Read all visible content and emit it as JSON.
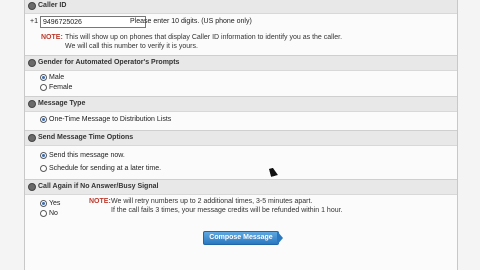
{
  "caller_id": {
    "title": "Caller ID",
    "prefix": "+1",
    "value": "9496725026",
    "hint": "Please enter 10 digits. (US phone only)",
    "note_kw": "NOTE:",
    "note_line1": "This will show up on phones that display Caller ID information to identify you as the caller.",
    "note_line2": "We will call this number to verify it is yours."
  },
  "gender": {
    "title": "Gender for Automated Operator's Prompts",
    "options": [
      "Male",
      "Female"
    ]
  },
  "message_type": {
    "title": "Message Type",
    "option": "One-Time Message to Distribution Lists"
  },
  "send_time": {
    "title": "Send Message Time Options",
    "options": [
      "Send this message now.",
      "Schedule for sending at a later time."
    ]
  },
  "call_again": {
    "title": "Call Again if No Answer/Busy Signal",
    "options": [
      "Yes",
      "No"
    ],
    "note_kw": "NOTE:",
    "note_line1": "We will retry numbers up to 2 additional times, 3-5 minutes apart.",
    "note_line2": "If the call fails 3 times, your message credits will be refunded within 1 hour."
  },
  "compose_button": "Compose Message"
}
